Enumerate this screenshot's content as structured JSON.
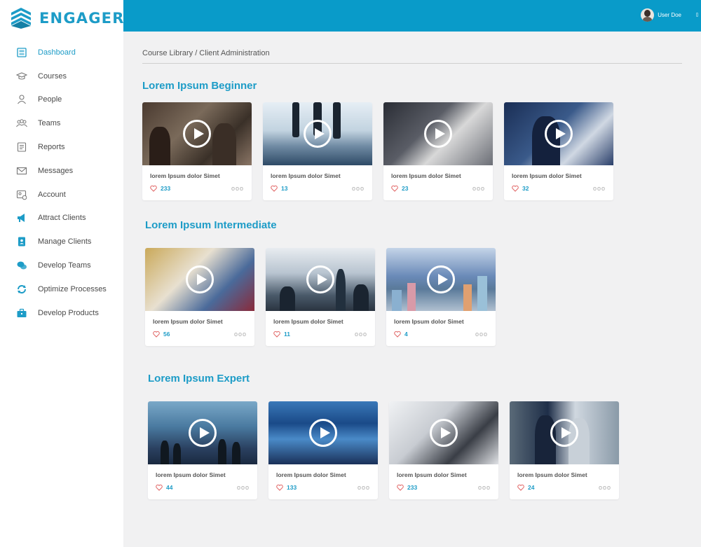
{
  "brand": {
    "name": "ENGAGER",
    "accent": "#1d9cc7",
    "topbar_color": "#099bc9"
  },
  "sidebar": {
    "items": [
      {
        "label": "Dashboard",
        "icon": "dashboard-icon",
        "active": true
      },
      {
        "label": "Courses",
        "icon": "graduation-cap-icon",
        "active": false
      },
      {
        "label": "People",
        "icon": "person-icon",
        "active": false
      },
      {
        "label": "Teams",
        "icon": "team-icon",
        "active": false
      },
      {
        "label": "Reports",
        "icon": "report-icon",
        "active": false
      },
      {
        "label": "Messages",
        "icon": "envelope-icon",
        "active": false
      },
      {
        "label": "Account",
        "icon": "account-icon",
        "active": false
      },
      {
        "label": "Attract Clients",
        "icon": "megaphone-icon",
        "active": false
      },
      {
        "label": "Manage Clients",
        "icon": "contact-book-icon",
        "active": false
      },
      {
        "label": "Develop Teams",
        "icon": "chat-bubbles-icon",
        "active": false
      },
      {
        "label": "Optimize Processes",
        "icon": "refresh-icon",
        "active": false
      },
      {
        "label": "Develop Products",
        "icon": "briefcase-icon",
        "active": false
      }
    ]
  },
  "header": {
    "user_name": "User Doe"
  },
  "breadcrumb": "Course Library / Client Administration",
  "sections": [
    {
      "title": "Lorem Ipsum Beginner",
      "cards": [
        {
          "title": "lorem Ipsum dolor Simet",
          "likes": "233",
          "more": "ooo"
        },
        {
          "title": "lorem Ipsum dolor Simet",
          "likes": "13",
          "more": "ooo"
        },
        {
          "title": "lorem Ipsum dolor Simet",
          "likes": "23",
          "more": "ooo"
        },
        {
          "title": "lorem Ipsum dolor Simet",
          "likes": "32",
          "more": "ooo"
        }
      ]
    },
    {
      "title": "Lorem Ipsum Intermediate",
      "cards": [
        {
          "title": "lorem Ipsum dolor Simet",
          "likes": "56",
          "more": "ooo"
        },
        {
          "title": "lorem Ipsum dolor Simet",
          "likes": "11",
          "more": "ooo"
        },
        {
          "title": "lorem Ipsum dolor Simet",
          "likes": "4",
          "more": "ooo"
        }
      ]
    },
    {
      "title": "Lorem Ipsum Expert",
      "cards": [
        {
          "title": "lorem Ipsum dolor Simet",
          "likes": "44",
          "more": "ooo"
        },
        {
          "title": "lorem Ipsum dolor Simet",
          "likes": "133",
          "more": "ooo"
        },
        {
          "title": "lorem Ipsum dolor Simet",
          "likes": "233",
          "more": "ooo"
        },
        {
          "title": "lorem Ipsum dolor Simet",
          "likes": "24",
          "more": "ooo"
        }
      ]
    }
  ]
}
